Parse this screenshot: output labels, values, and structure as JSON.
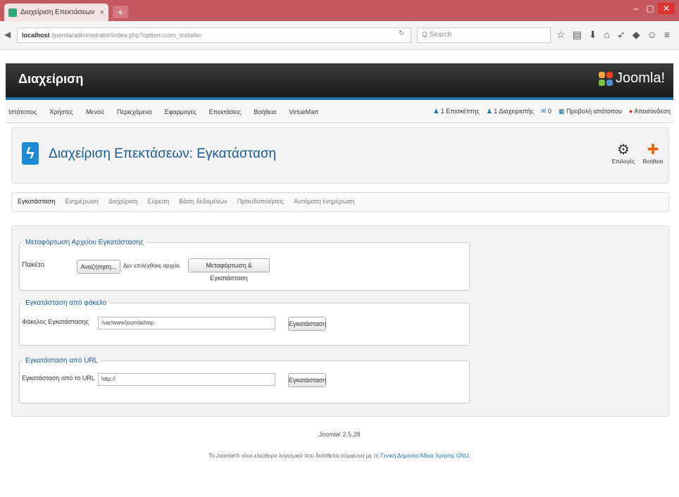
{
  "browser": {
    "tab_title": "Διαχείριση Επεκτάσεων - Ε...",
    "tab_close": "×",
    "new_tab": "+",
    "url_host": "localhost",
    "url_path": "/joomla/administrator/index.php?option=com_installer",
    "search_placeholder": "Q Search"
  },
  "admin": {
    "title": "Διαχείριση",
    "logo_text": "Joomla!",
    "menu": [
      "Ιστότοπος",
      "Χρήστες",
      "Μενού",
      "Περιεχόμενο",
      "Εφαρμογές",
      "Επεκτάσεις",
      "Βοήθεια",
      "VirtueMart"
    ],
    "status": [
      "1 Επισκέπτης",
      "1 Διαχειριστής",
      "0",
      "Προβολή ιστότοπου",
      "Αποσύνδεση"
    ]
  },
  "page": {
    "title": "Διαχείριση Επεκτάσεων: Εγκατάσταση",
    "toolbar": [
      {
        "label": "Επιλογές",
        "icon": "options-icon"
      },
      {
        "label": "Βοήθεια",
        "icon": "help-icon"
      }
    ],
    "tabs": [
      "Εγκατάσταση",
      "Ενημέρωση",
      "Διαχείριση",
      "Εύρεση",
      "Βάση δεδομένων",
      "Προειδοποιήσεις",
      "Αυτόματη ενημέρωση"
    ]
  },
  "upload": {
    "legend": "Μεταφόρτωση Αρχείου Εγκατάστασης",
    "label": "Πακέτο",
    "browse_button": "Αναζήτηση...",
    "no_file": "Δεν επιλέχθηκε αρχείο.",
    "submit_button": "Μεταφόρτωση & Εγκατάσταση"
  },
  "folder": {
    "legend": "Εγκατάσταση από φάκελο",
    "label": "Φάκελος Εγκατάστασης",
    "value": "/var/www/joomla/tmp",
    "button": "Εγκατάσταση"
  },
  "url_install": {
    "legend": "Εγκατάσταση από URL",
    "label": "Εγκατάσταση από το URL",
    "value": "http://",
    "button": "Εγκατάσταση"
  },
  "footer": {
    "version": "Joomla! 2.5.28",
    "credit_prefix": "Το Joomla!® είναι ελεύθερο λογισμικό που διατίθεται σύμφωνα με τη ",
    "credit_link": "Γενική Δημόσια Άδεια Χρήσης GNU."
  },
  "colors": {
    "brand_blue": "#1d6fa5",
    "tab_bar": "#c45a5f"
  }
}
